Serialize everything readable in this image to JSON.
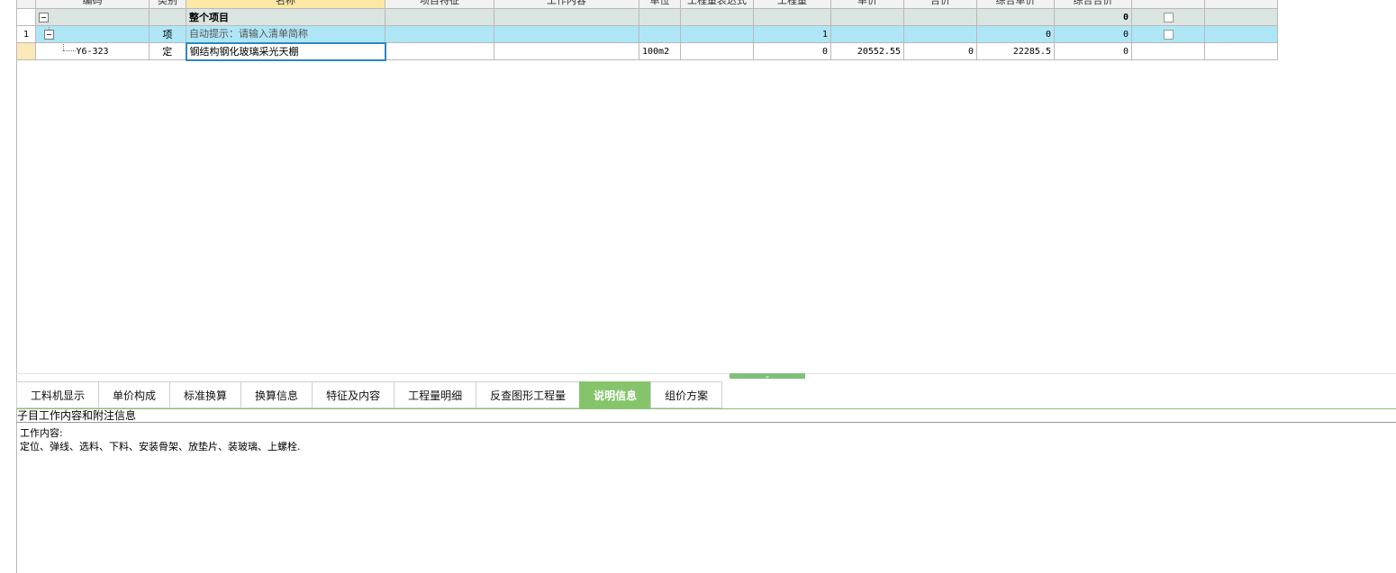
{
  "grid": {
    "columns": [
      "编码",
      "类别",
      "名称",
      "项目特征",
      "工作内容",
      "单位",
      "工程量表达式",
      "工程量",
      "单价",
      "合价",
      "综合单价",
      "综合合价",
      "",
      ""
    ],
    "rows": [
      {
        "row_num": "",
        "code": "",
        "type": "",
        "name": "整个项目",
        "unit": "",
        "quantity": "",
        "price": "",
        "total": "",
        "comp_price": "",
        "comp_total": "0"
      },
      {
        "row_num": "1",
        "code": "",
        "type": "项",
        "name": "自动提示：请输入清单简称",
        "unit": "",
        "quantity": "1",
        "price": "",
        "total": "",
        "comp_price": "0",
        "comp_total": "0"
      },
      {
        "row_num": "",
        "code": "Y6-323",
        "type": "定",
        "name": "钢结构钢化玻璃采光天棚",
        "unit": "100m2",
        "quantity": "0",
        "price": "20552.55",
        "total": "0",
        "comp_price": "22285.5",
        "comp_total": "0"
      }
    ]
  },
  "icons": {
    "collapse": "collapse-minus-icon",
    "checkbox": "checkbox-icon",
    "splitter": "chevron-down-icon"
  },
  "tabs": [
    {
      "label": "工料机显示",
      "active": false
    },
    {
      "label": "单价构成",
      "active": false
    },
    {
      "label": "标准换算",
      "active": false
    },
    {
      "label": "换算信息",
      "active": false
    },
    {
      "label": "特征及内容",
      "active": false
    },
    {
      "label": "工程量明细",
      "active": false
    },
    {
      "label": "反查图形工程量",
      "active": false
    },
    {
      "label": "说明信息",
      "active": true
    },
    {
      "label": "组价方案",
      "active": false
    }
  ],
  "info_panel": {
    "title": "子目工作内容和附注信息",
    "work_content_label": "工作内容:",
    "work_content_text": "定位、弹线、选料、下料、安装骨架、放垫片、装玻璃、上螺栓."
  },
  "colors": {
    "active_tab": "#86c46b",
    "item_row": "#aee6f6",
    "summary_row": "#dae4e0",
    "selected_header": "#fde9a5"
  }
}
